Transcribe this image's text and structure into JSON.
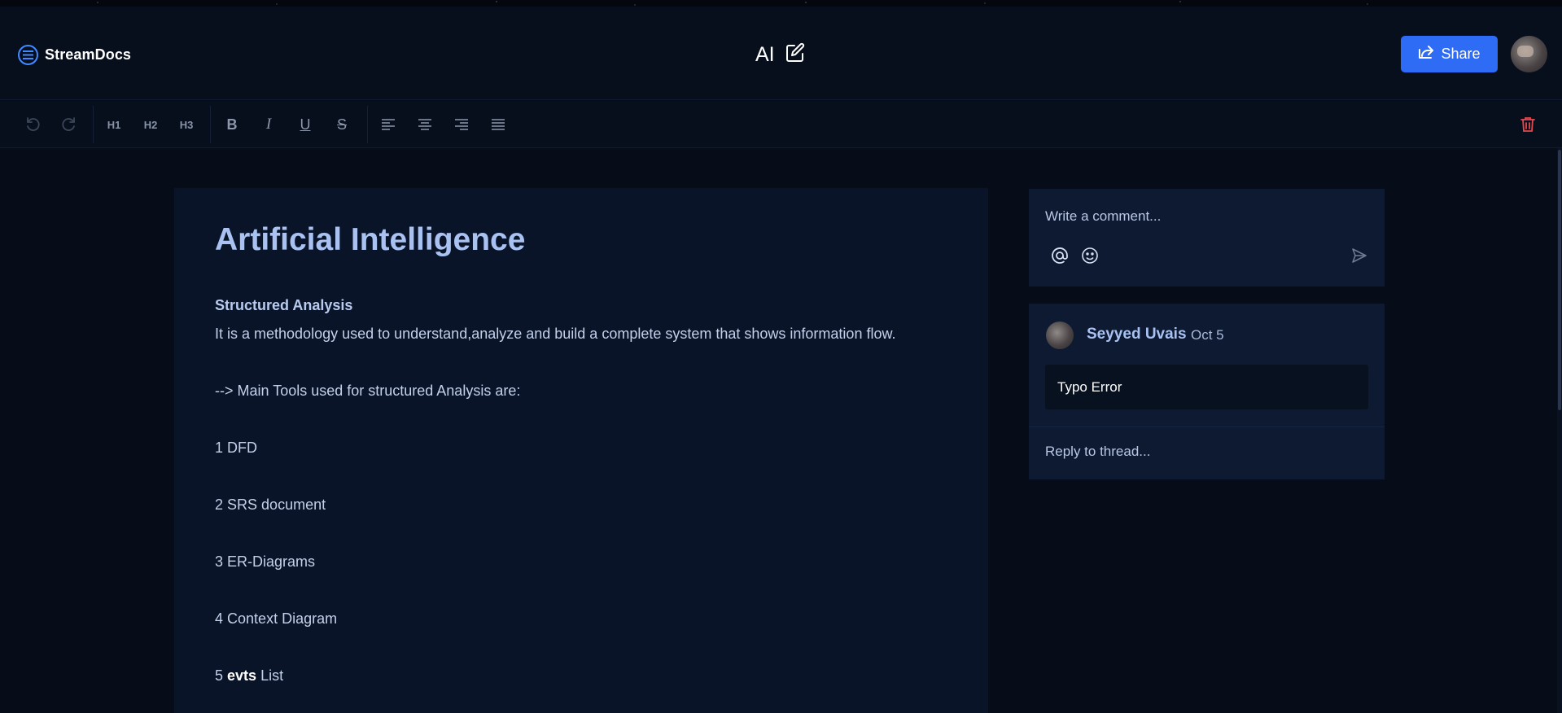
{
  "app": {
    "brand_name": "StreamDocs",
    "accent_color": "#2f6cf6"
  },
  "header": {
    "doc_title": "AI",
    "share_label": "Share"
  },
  "toolbar": {
    "h1_label": "H1",
    "h2_label": "H2",
    "h3_label": "H3",
    "bold_label": "B",
    "italic_label": "I",
    "underline_label": "U",
    "strike_label": "S"
  },
  "document": {
    "title": "Artificial Intelligence",
    "section_heading": "Structured Analysis",
    "line1": "It is a methodology used to understand,analyze and build a complete system that shows information flow.",
    "line2": "--> Main Tools used for structured Analysis are:",
    "items": [
      {
        "num": "1",
        "text": "DFD"
      },
      {
        "num": "2",
        "text": "SRS document"
      },
      {
        "num": "3",
        "text": "ER-Diagrams"
      },
      {
        "num": "4",
        "text": "Context Diagram"
      }
    ],
    "item5": {
      "num": "5",
      "strong": "evts",
      "text": "List"
    }
  },
  "comments": {
    "placeholder": "Write a comment...",
    "thread": {
      "author": "Seyyed Uvais",
      "date": "Oct 5",
      "message": "Typo Error",
      "reply_placeholder": "Reply to thread..."
    }
  }
}
